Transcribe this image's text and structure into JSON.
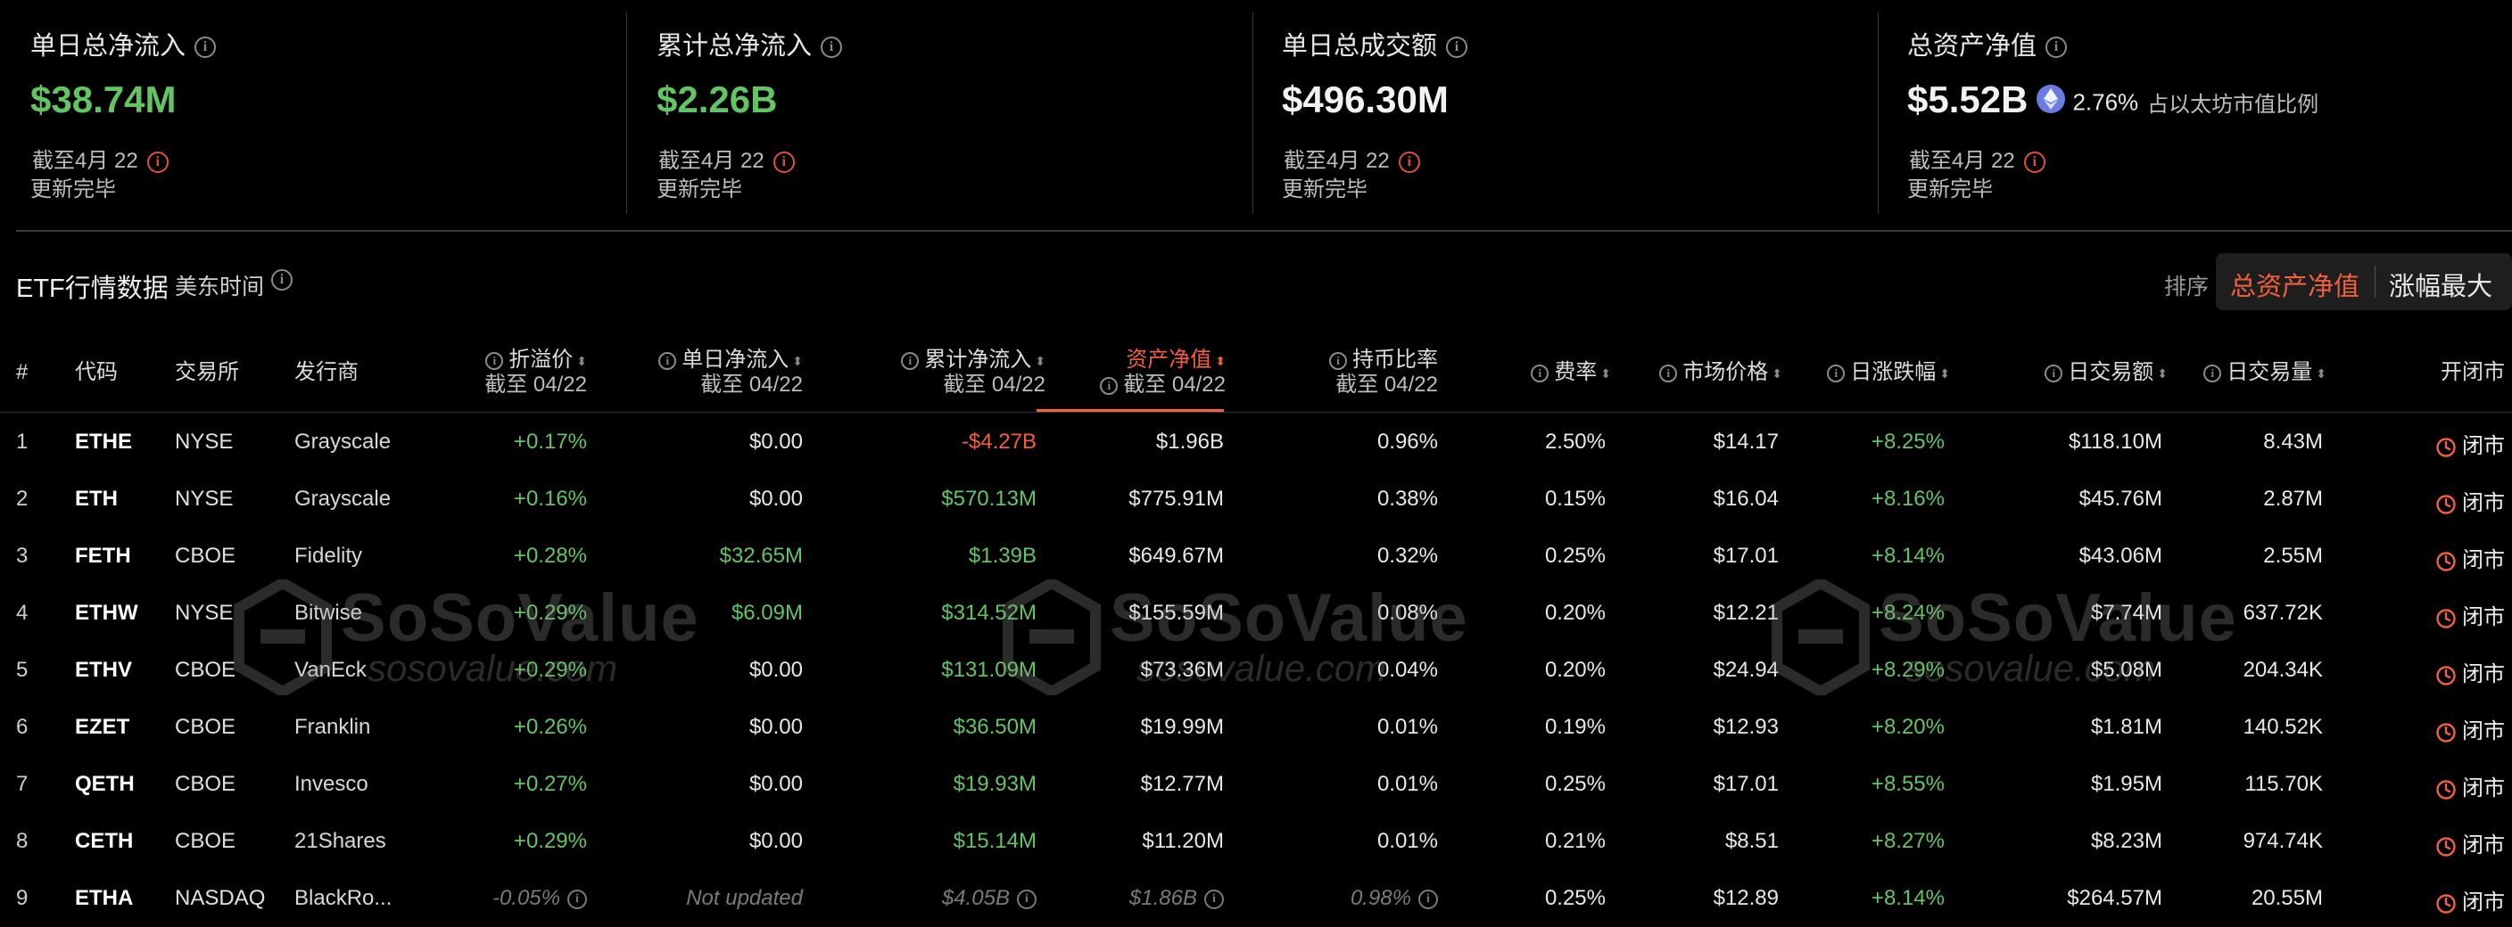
{
  "stats": [
    {
      "title": "单日总净流入",
      "value": "$38.74M",
      "date": "截至4月 22",
      "status": "更新完毕",
      "color": "green"
    },
    {
      "title": "累计总净流入",
      "value": "$2.26B",
      "date": "截至4月 22",
      "status": "更新完毕",
      "color": "green"
    },
    {
      "title": "单日总成交额",
      "value": "$496.30M",
      "date": "截至4月 22",
      "status": "更新完毕",
      "color": "white"
    },
    {
      "title": "总资产净值",
      "value": "$5.52B",
      "pct": "2.76%",
      "note": "占以太坊市值比例",
      "date": "截至4月 22",
      "status": "更新完毕",
      "color": "white"
    }
  ],
  "section": {
    "title": "ETF行情数据",
    "timezone": "美东时间",
    "sort_label": "排序",
    "sort_active": "总资产净值",
    "sort_other": "涨幅最大"
  },
  "columns": {
    "num": "#",
    "code": "代码",
    "exchange": "交易所",
    "issuer": "发行商",
    "premium": "折溢价",
    "daily_inflow": "单日净流入",
    "cum_inflow": "累计净流入",
    "nav": "资产净值",
    "holding": "持币比率",
    "fee": "费率",
    "price": "市场价格",
    "change": "日涨跌幅",
    "turnover": "日交易额",
    "volume": "日交易量",
    "status": "开闭市",
    "as_of": "截至 04/22"
  },
  "rows": [
    {
      "num": "1",
      "code": "ETHE",
      "exchange": "NYSE",
      "issuer": "Grayscale",
      "premium": "+0.17%",
      "daily": "$0.00",
      "cum": "-$4.27B",
      "nav": "$1.96B",
      "holding": "0.96%",
      "fee": "2.50%",
      "price": "$14.17",
      "change": "+8.25%",
      "turnover": "$118.10M",
      "volume": "8.43M",
      "status": "闭市"
    },
    {
      "num": "2",
      "code": "ETH",
      "exchange": "NYSE",
      "issuer": "Grayscale",
      "premium": "+0.16%",
      "daily": "$0.00",
      "cum": "$570.13M",
      "nav": "$775.91M",
      "holding": "0.38%",
      "fee": "0.15%",
      "price": "$16.04",
      "change": "+8.16%",
      "turnover": "$45.76M",
      "volume": "2.87M",
      "status": "闭市"
    },
    {
      "num": "3",
      "code": "FETH",
      "exchange": "CBOE",
      "issuer": "Fidelity",
      "premium": "+0.28%",
      "daily": "$32.65M",
      "cum": "$1.39B",
      "nav": "$649.67M",
      "holding": "0.32%",
      "fee": "0.25%",
      "price": "$17.01",
      "change": "+8.14%",
      "turnover": "$43.06M",
      "volume": "2.55M",
      "status": "闭市"
    },
    {
      "num": "4",
      "code": "ETHW",
      "exchange": "NYSE",
      "issuer": "Bitwise",
      "premium": "+0.29%",
      "daily": "$6.09M",
      "cum": "$314.52M",
      "nav": "$155.59M",
      "holding": "0.08%",
      "fee": "0.20%",
      "price": "$12.21",
      "change": "+8.24%",
      "turnover": "$7.74M",
      "volume": "637.72K",
      "status": "闭市"
    },
    {
      "num": "5",
      "code": "ETHV",
      "exchange": "CBOE",
      "issuer": "VanEck",
      "premium": "+0.29%",
      "daily": "$0.00",
      "cum": "$131.09M",
      "nav": "$73.36M",
      "holding": "0.04%",
      "fee": "0.20%",
      "price": "$24.94",
      "change": "+8.29%",
      "turnover": "$5.08M",
      "volume": "204.34K",
      "status": "闭市"
    },
    {
      "num": "6",
      "code": "EZET",
      "exchange": "CBOE",
      "issuer": "Franklin",
      "premium": "+0.26%",
      "daily": "$0.00",
      "cum": "$36.50M",
      "nav": "$19.99M",
      "holding": "0.01%",
      "fee": "0.19%",
      "price": "$12.93",
      "change": "+8.20%",
      "turnover": "$1.81M",
      "volume": "140.52K",
      "status": "闭市"
    },
    {
      "num": "7",
      "code": "QETH",
      "exchange": "CBOE",
      "issuer": "Invesco",
      "premium": "+0.27%",
      "daily": "$0.00",
      "cum": "$19.93M",
      "nav": "$12.77M",
      "holding": "0.01%",
      "fee": "0.25%",
      "price": "$17.01",
      "change": "+8.55%",
      "turnover": "$1.95M",
      "volume": "115.70K",
      "status": "闭市"
    },
    {
      "num": "8",
      "code": "CETH",
      "exchange": "CBOE",
      "issuer": "21Shares",
      "premium": "+0.29%",
      "daily": "$0.00",
      "cum": "$15.14M",
      "nav": "$11.20M",
      "holding": "0.01%",
      "fee": "0.21%",
      "price": "$8.51",
      "change": "+8.27%",
      "turnover": "$8.23M",
      "volume": "974.74K",
      "status": "闭市"
    },
    {
      "num": "9",
      "code": "ETHA",
      "exchange": "NASDAQ",
      "issuer": "BlackRo...",
      "premium": "-0.05%",
      "daily": "Not updated",
      "cum": "$4.05B",
      "nav": "$1.86B",
      "holding": "0.98%",
      "fee": "0.25%",
      "price": "$12.89",
      "change": "+8.14%",
      "turnover": "$264.57M",
      "volume": "20.55M",
      "status": "闭市"
    }
  ],
  "watermark": {
    "name": "SoSoValue",
    "url": "sosovalue.com"
  },
  "colors": {
    "positive": "#62c462",
    "negative": "#f0603f",
    "accent": "#f0603f",
    "background": "#000000"
  }
}
